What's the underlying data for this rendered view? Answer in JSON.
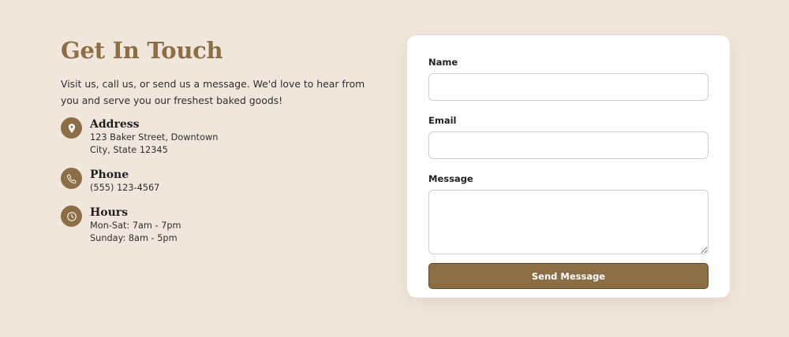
{
  "contact": {
    "title": "Get In Touch",
    "intro": "Visit us, call us, or send us a message. We'd love to hear from you and serve you our freshest baked goods!",
    "items": [
      {
        "icon": "map-pin-icon",
        "heading": "Address",
        "lines": [
          "123 Baker Street, Downtown",
          "City, State 12345"
        ]
      },
      {
        "icon": "phone-icon",
        "heading": "Phone",
        "lines": [
          "(555) 123-4567"
        ]
      },
      {
        "icon": "clock-icon",
        "heading": "Hours",
        "lines": [
          "Mon-Sat: 7am - 7pm",
          "Sunday: 8am - 5pm"
        ]
      }
    ]
  },
  "form": {
    "name_label": "Name",
    "name_value": "",
    "email_label": "Email",
    "email_value": "",
    "message_label": "Message",
    "message_value": "",
    "submit_label": "Send Message"
  },
  "colors": {
    "background": "#f1e6dc",
    "accent": "#8b6e45",
    "card": "#ffffff"
  }
}
